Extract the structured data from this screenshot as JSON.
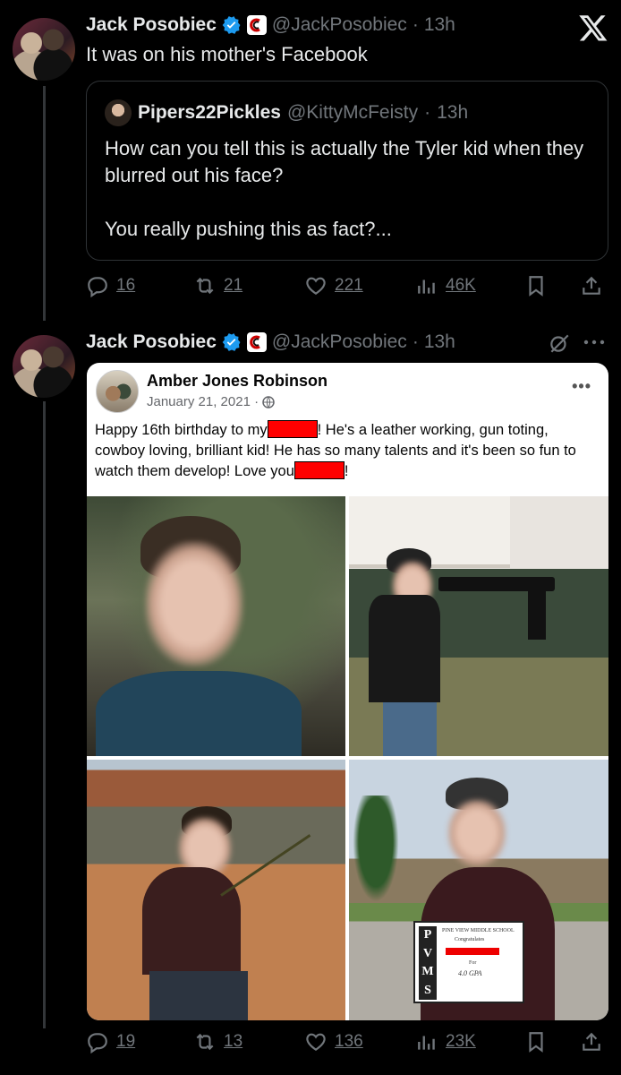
{
  "post1": {
    "author_name": "Jack Posobiec",
    "handle": "@JackPosobiec",
    "separator": "·",
    "time": "13h",
    "text": "It was on his mother's Facebook",
    "quote": {
      "author_name": "Pipers22Pickles",
      "handle": "@KittyMcFeisty",
      "separator": "·",
      "time": "13h",
      "line1": "How can you tell this is actually the Tyler kid when they blurred out his face?",
      "line2": "You really pushing this as fact?..."
    },
    "actions": {
      "replies": "16",
      "reposts": "21",
      "likes": "221",
      "views": "46K"
    }
  },
  "post2": {
    "author_name": "Jack Posobiec",
    "handle": "@JackPosobiec",
    "separator": "·",
    "time": "13h",
    "fb": {
      "name": "Amber Jones Robinson",
      "date": "January 21, 2021 ·",
      "text_a": "Happy 16th birthday to my",
      "text_b": "! He's a leather working, gun toting, cowboy loving, brilliant kid! He has so many talents and it's been so fun to watch them develop! Love you",
      "text_c": "!",
      "cert_school": "PINE VIEW MIDDLE SCHOOL",
      "cert_congrats": "Congratulates",
      "cert_for": "For",
      "cert_gpa": "4.0 GPA",
      "cert_letters": [
        "P",
        "V",
        "M",
        "S"
      ]
    },
    "actions": {
      "replies": "19",
      "reposts": "13",
      "likes": "136",
      "views": "23K"
    }
  },
  "colors": {
    "background": "#000000",
    "muted": "#71767b",
    "verified": "#1d9bf0",
    "redaction": "#ff0000"
  }
}
